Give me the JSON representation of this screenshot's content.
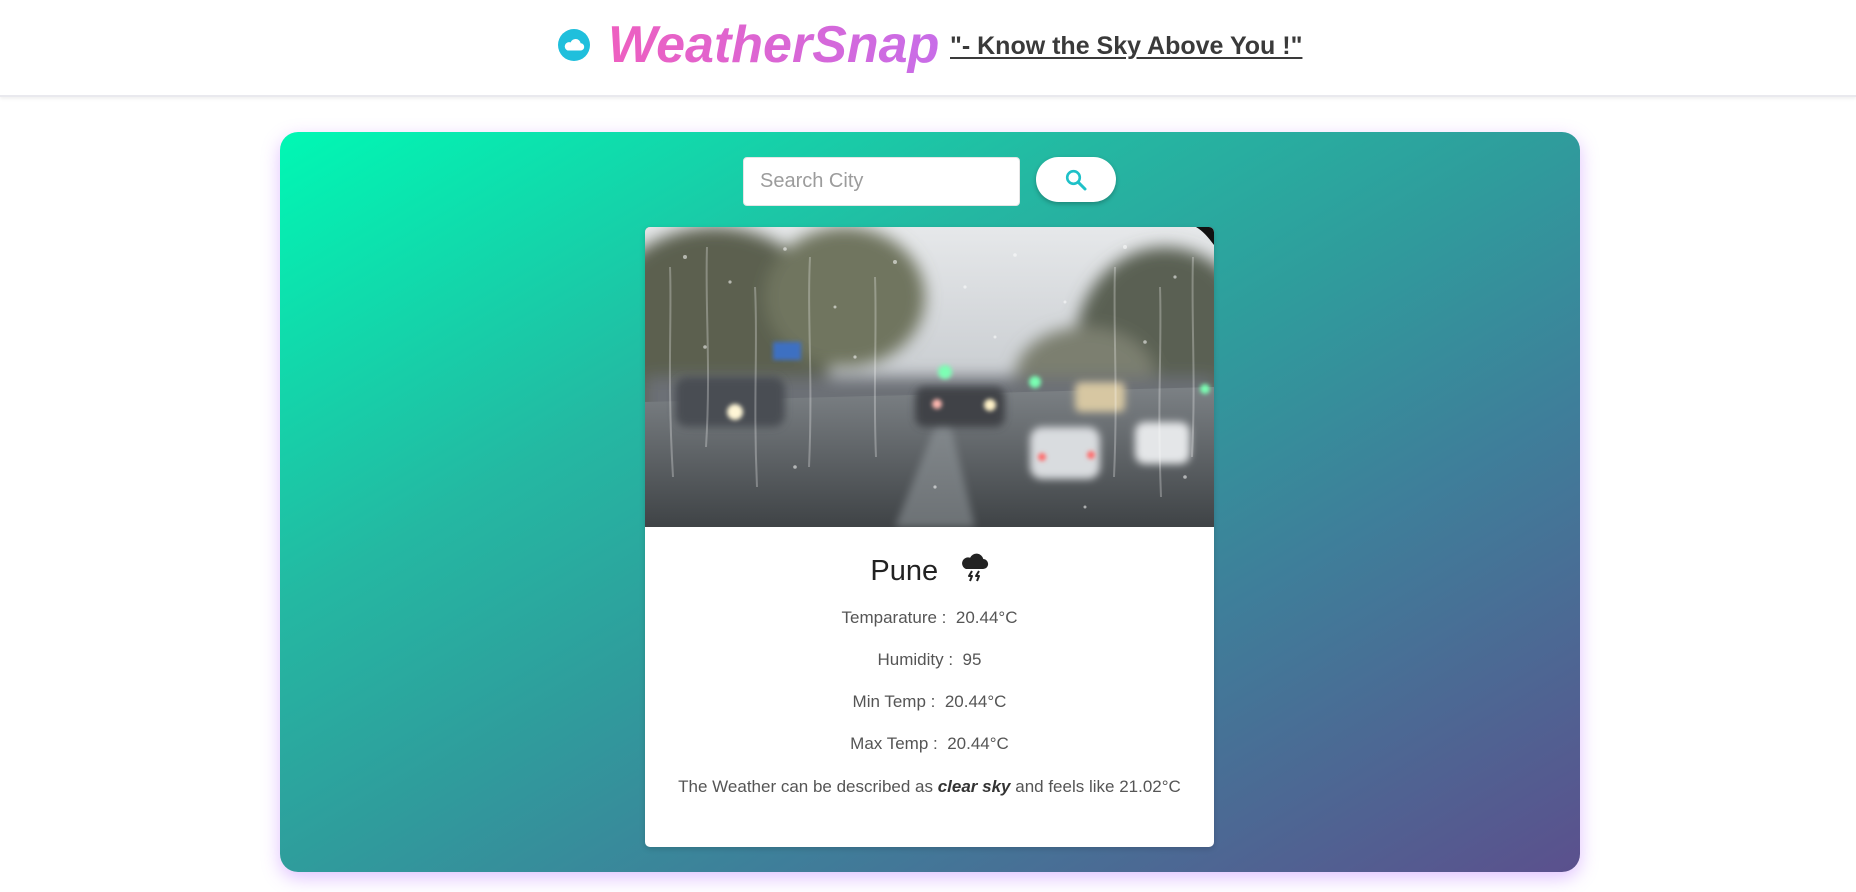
{
  "header": {
    "brand": "WeatherSnap",
    "tagline": "\"- Know the Sky Above You !\"",
    "logo_icon": "cloud-icon",
    "brand_gradient": [
      "#ee5fc0",
      "#c86de8"
    ]
  },
  "search": {
    "placeholder": "Search City",
    "value": "",
    "button_icon": "search-icon",
    "accent": "#1fc1c8"
  },
  "panel": {
    "gradient": [
      "#00f8b4",
      "#2f9c9c",
      "#5b508d"
    ]
  },
  "weather": {
    "photo": "rainy-window-street",
    "city": "Pune",
    "condition_icon": "thunderstorm-cloud-icon",
    "temperature_label": "Temparature :",
    "temperature_value": "20.44°C",
    "humidity_label": "Humidity :",
    "humidity_value": "95",
    "min_label": "Min Temp :",
    "min_value": "20.44°C",
    "max_label": "Max Temp :",
    "max_value": "20.44°C",
    "desc_prefix": "The Weather can be described as ",
    "desc_condition": "clear sky",
    "desc_middle": " and feels like ",
    "feels_like": "21.02°C"
  }
}
